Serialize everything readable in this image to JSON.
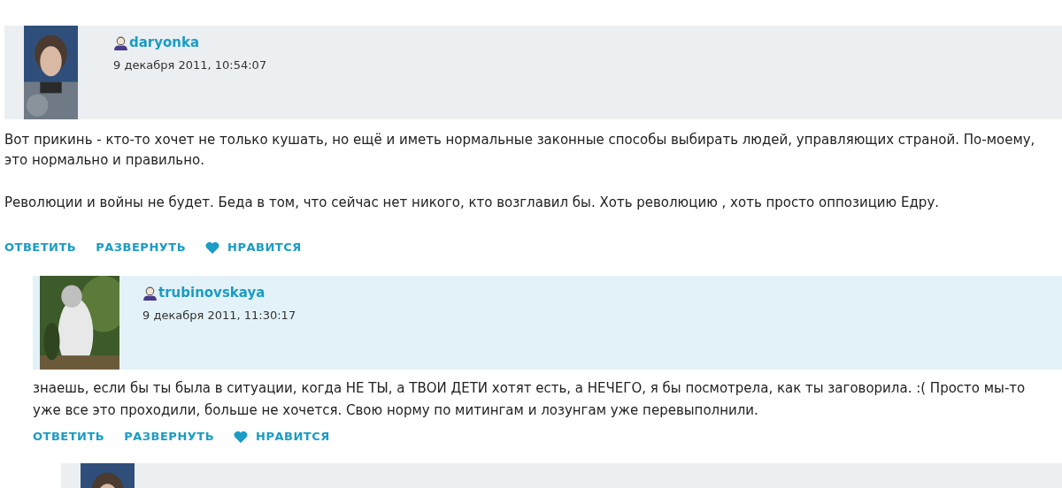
{
  "comments": [
    {
      "highlighted": false,
      "avatar": {
        "kind": "picture"
      },
      "user": "daryonka",
      "date": "9 декабря 2011, 10:54:07",
      "paragraphs": [
        "Вот прикинь - кто-то хочет не только кушать, но ещё и иметь нормальные законные способы выбирать людей, управляющих страной. По-моему, это нормально и правильно.",
        "Революции и войны не будет. Беда в том, что сейчас нет никого, кто возглавил бы. Хоть революцию , хоть просто оппозицию Едру."
      ],
      "actions": [
        {
          "label": "ОТВЕТИТЬ",
          "kind": "text"
        },
        {
          "label": "РАЗВЕРНУТЬ",
          "kind": "text"
        },
        {
          "label": "НРАВИТСЯ",
          "kind": "like"
        }
      ],
      "children": [
        {
          "highlighted": true,
          "avatar": {
            "kind": "picture"
          },
          "user": "trubinovskaya",
          "date": "9 декабря 2011, 11:30:17",
          "paragraphs": [
            "знаешь, если бы ты была в ситуации, когда НЕ ТЫ, а ТВОИ ДЕТИ хотят есть, а НЕЧЕГО, я бы посмотрела, как ты заговорила. :( Просто мы-то уже все это проходили, больше не хочется. Свою норму по митингам и лозунгам уже перевыполнили."
          ],
          "actions": [
            {
              "label": "ОТВЕТИТЬ",
              "kind": "text"
            },
            {
              "label": "РАЗВЕРНУТЬ",
              "kind": "text"
            },
            {
              "label": "НРАВИТСЯ",
              "kind": "like"
            }
          ],
          "children": [
            {
              "avatar": {
                "kind": "picture"
              }
            }
          ]
        }
      ]
    }
  ]
}
